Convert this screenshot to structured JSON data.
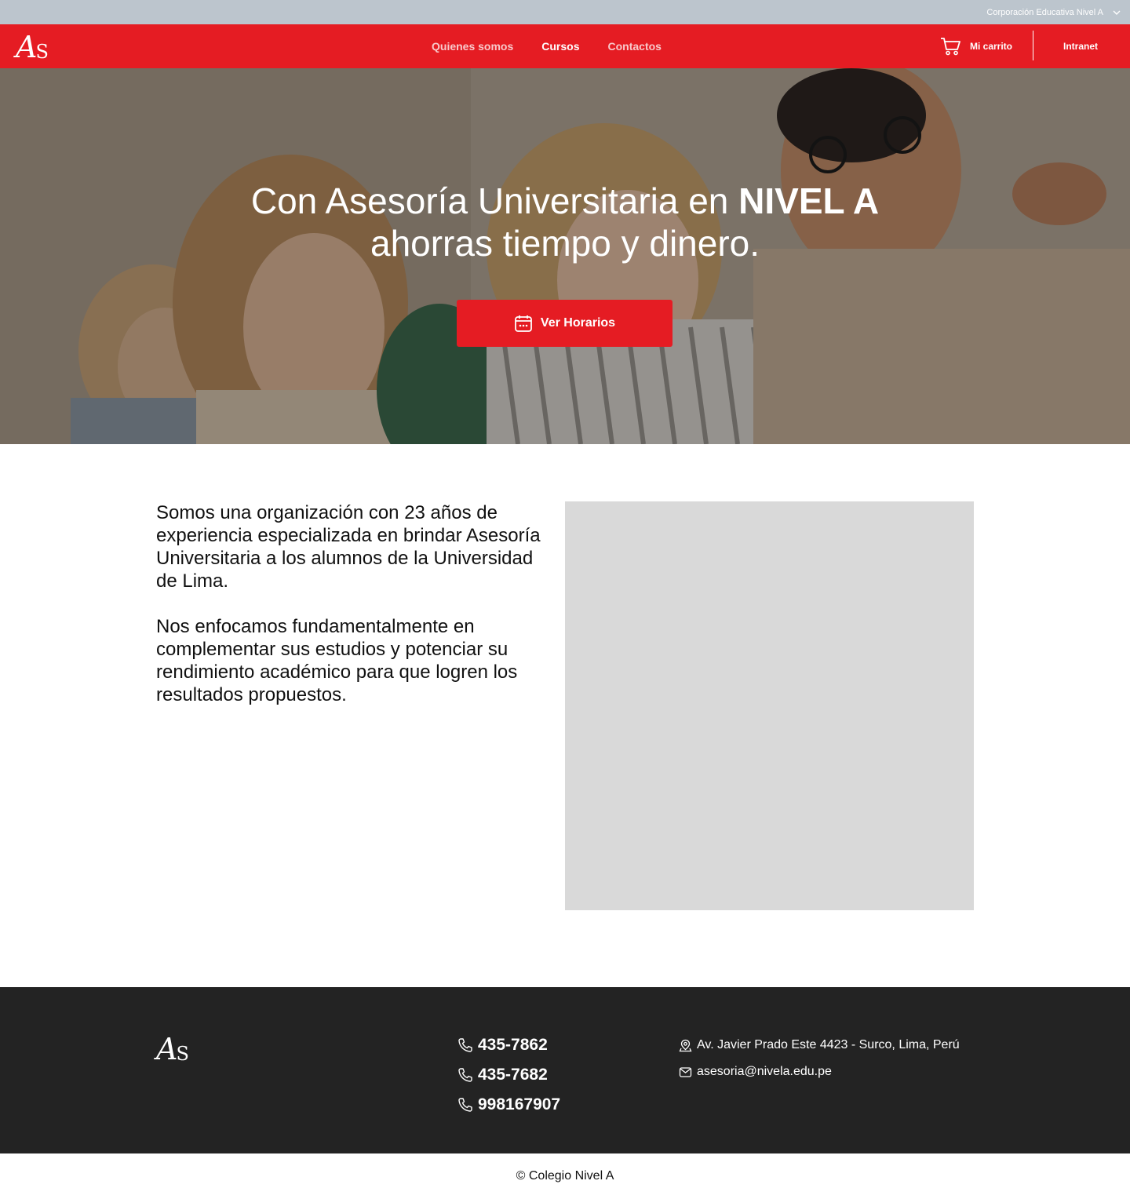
{
  "topbar": {
    "corporation": "Corporación Educativa Nivel A",
    "chevron_icon": "chevron-down-icon"
  },
  "brand": {
    "logo_big": "A",
    "logo_small": "S"
  },
  "nav": {
    "links": [
      {
        "label": "Quienes somos",
        "active": false
      },
      {
        "label": "Cursos",
        "active": true
      },
      {
        "label": "Contactos",
        "active": false
      }
    ],
    "cart_label": "Mi carrito",
    "cart_icon": "cart-icon",
    "intranet_label": "Intranet"
  },
  "hero": {
    "title_part1": "Con Asesoría Universitaria en ",
    "title_bold": "NIVEL A",
    "title_part2": "ahorras tiempo y dinero.",
    "button_label": "Ver Horarios",
    "button_icon": "calendar-icon"
  },
  "about": {
    "paragraph1": "Somos una organización con 23 años de experiencia especializada en brindar Asesoría Universitaria a los alumnos de la Universidad de Lima.",
    "paragraph2": "Nos enfocamos fundamentalmente en complementar sus estudios y potenciar su rendimiento académico para que logren los resultados propuestos."
  },
  "footer": {
    "phones": [
      "435-7862",
      "435-7682",
      "998167907"
    ],
    "address": "Av. Javier Prado Este 4423 - Surco, Lima, Perú",
    "email": "asesoria@nivela.edu.pe",
    "copyright": "© Colegio Nivel A"
  },
  "colors": {
    "brand_red": "#e51c23",
    "topbar": "#bcc5cd",
    "footer_bg": "#232323",
    "placeholder": "#d9d9d9"
  }
}
